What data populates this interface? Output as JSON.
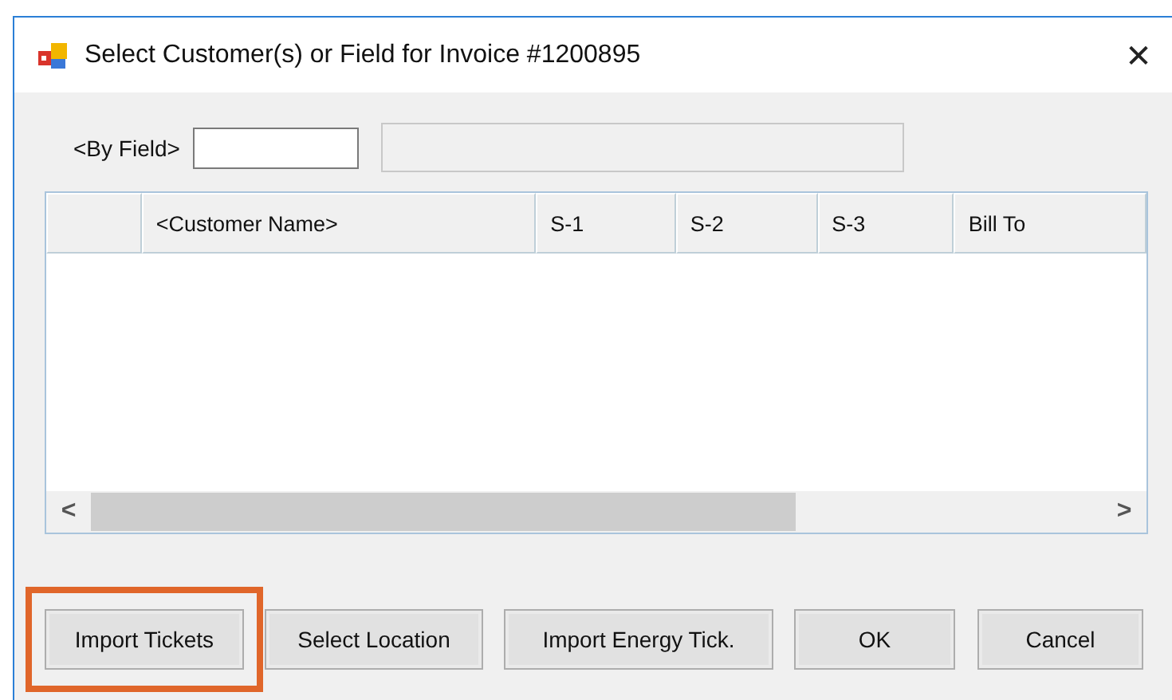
{
  "window": {
    "title": "Select Customer(s) or Field for Invoice #1200895",
    "close": "✕"
  },
  "filter": {
    "label": "<By Field>",
    "value_field": {
      "disabled": false
    },
    "description_field": {
      "disabled": true
    }
  },
  "table": {
    "columns": [
      "<Customer Name>",
      "S-1",
      "S-2",
      "S-3",
      "Bill To"
    ],
    "scroll_left": "<",
    "scroll_right": ">"
  },
  "buttons": [
    {
      "label": "Import Tickets",
      "highlighted": true
    },
    {
      "label": "Select Location",
      "highlighted": false
    },
    {
      "label": "Import Energy Tick.",
      "highlighted": false
    },
    {
      "label": "OK",
      "highlighted": false
    },
    {
      "label": "Cancel",
      "highlighted": false
    }
  ]
}
